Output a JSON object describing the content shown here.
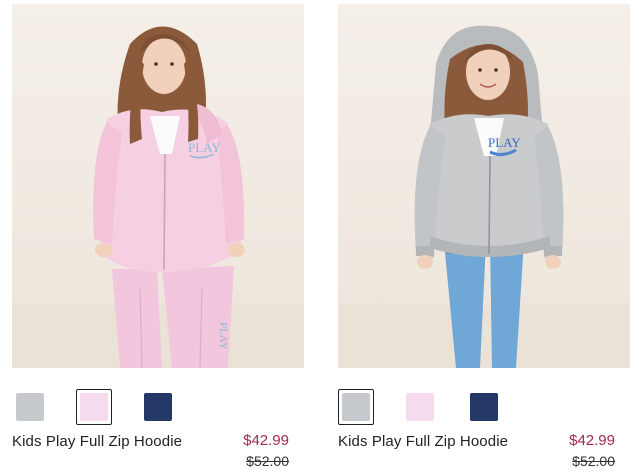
{
  "products": [
    {
      "name": "Kids Play Full Zip Hoodie",
      "sale_price": "$42.99",
      "original_price": "$52.00",
      "print_text": "PLAY",
      "swatches": [
        {
          "color": "#c7cacd",
          "label": "gray"
        },
        {
          "color": "#f6dbef",
          "label": "pink",
          "selected": true
        },
        {
          "color": "#233866",
          "label": "navy"
        }
      ]
    },
    {
      "name": "Kids Play Full Zip Hoodie",
      "sale_price": "$42.99",
      "original_price": "$52.00",
      "print_text": "PLAY",
      "swatches": [
        {
          "color": "#c7cacd",
          "label": "gray",
          "selected": true
        },
        {
          "color": "#f6dbef",
          "label": "pink"
        },
        {
          "color": "#233866",
          "label": "navy"
        }
      ]
    }
  ]
}
